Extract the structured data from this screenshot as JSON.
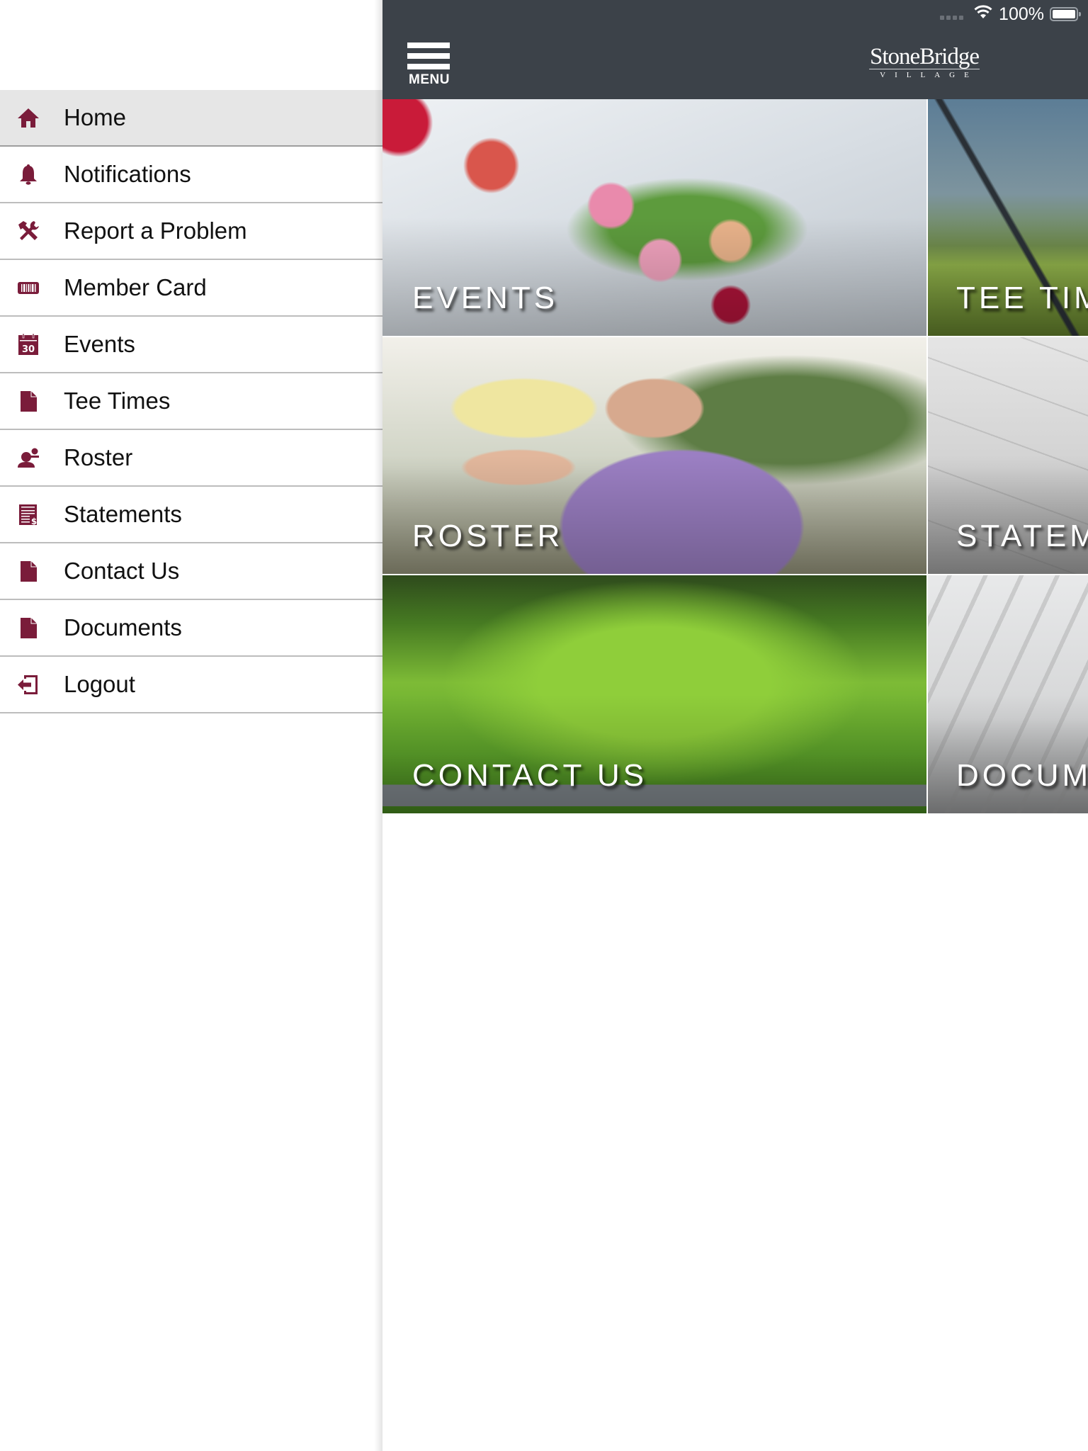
{
  "status_bar": {
    "battery_percent_label": "100%",
    "battery_level": 1.0,
    "wifi_icon": "wifi-icon",
    "signal_icon": "cellular-signal-icon"
  },
  "header": {
    "menu_label": "MENU",
    "menu_icon": "hamburger-menu-icon",
    "logo_name": "StoneBridge",
    "logo_sub": "VILLAGE",
    "background_color": "#3c4249"
  },
  "sidebar": {
    "accent_color": "#7a1c3a",
    "active_item": "Home",
    "items": [
      {
        "label": "Home",
        "icon": "home-icon"
      },
      {
        "label": "Notifications",
        "icon": "bell-icon"
      },
      {
        "label": "Report a Problem",
        "icon": "tools-icon"
      },
      {
        "label": "Member Card",
        "icon": "barcode-card-icon"
      },
      {
        "label": "Events",
        "icon": "calendar-icon",
        "icon_text": "30"
      },
      {
        "label": "Tee Times",
        "icon": "document-icon"
      },
      {
        "label": "Roster",
        "icon": "people-icon"
      },
      {
        "label": "Statements",
        "icon": "statement-dollar-icon"
      },
      {
        "label": "Contact Us",
        "icon": "document-icon"
      },
      {
        "label": "Documents",
        "icon": "document-icon"
      },
      {
        "label": "Logout",
        "icon": "logout-icon"
      }
    ]
  },
  "tiles": [
    {
      "label": "EVENTS",
      "image": "table-flowers-photo"
    },
    {
      "label": "TEE TIMES",
      "image": "golf-club-grass-photo"
    },
    {
      "label": "ROSTER",
      "image": "smiling-golfers-photo"
    },
    {
      "label": "STATEMENTS",
      "image": "statement-paper-photo"
    },
    {
      "label": "CONTACT US",
      "image": "stonebridge-course-entrance-photo"
    },
    {
      "label": "DOCUMENTS",
      "image": "paper-stack-photo"
    }
  ]
}
